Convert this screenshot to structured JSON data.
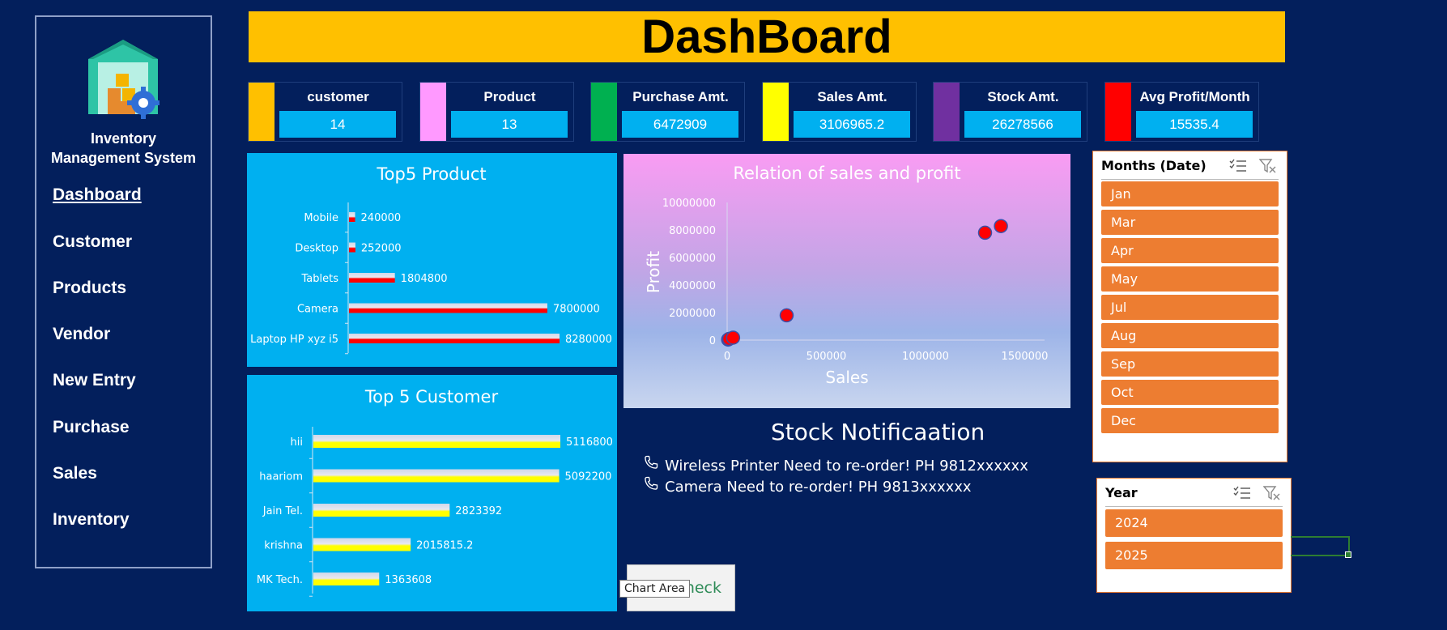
{
  "sidebar": {
    "title_line1": "Inventory",
    "title_line2": "Management System",
    "items": [
      {
        "label": "Dashboard",
        "active": true
      },
      {
        "label": "Customer"
      },
      {
        "label": "Products"
      },
      {
        "label": "Vendor"
      },
      {
        "label": "New Entry"
      },
      {
        "label": "Purchase"
      },
      {
        "label": "Sales"
      },
      {
        "label": "Inventory"
      }
    ]
  },
  "header": {
    "title": "DashBoard"
  },
  "kpis": [
    {
      "label": "customer",
      "value": "14",
      "color": "#ffc000"
    },
    {
      "label": "Product",
      "value": "13",
      "color": "#ff99ff"
    },
    {
      "label": "Purchase Amt.",
      "value": "6472909",
      "color": "#00b050"
    },
    {
      "label": "Sales Amt.",
      "value": "3106965.2",
      "color": "#ffff00"
    },
    {
      "label": "Stock Amt.",
      "value": "26278566",
      "color": "#7030a0"
    },
    {
      "label": "Avg Profit/Month",
      "value": "15535.4",
      "color": "#ff0000"
    }
  ],
  "chart_data": [
    {
      "type": "bar",
      "title": "Top5 Product",
      "categories": [
        "Mobile",
        "Desktop",
        "Tablets",
        "Camera",
        "Laptop HP xyz i5"
      ],
      "values": [
        240000,
        252000,
        1804800,
        7800000,
        8280000
      ],
      "data_labels": [
        "240000",
        "252000",
        "1804800",
        "7800000",
        "8280000"
      ],
      "orientation": "horizontal",
      "bar_color": "#ff0000"
    },
    {
      "type": "bar",
      "title": "Top 5 Customer",
      "categories": [
        "hii",
        "haariom",
        "Jain Tel.",
        "krishna",
        "MK Tech."
      ],
      "values": [
        5116800,
        5092200,
        2823392,
        2015815.2,
        1363608
      ],
      "data_labels": [
        "5116800",
        "5092200",
        "2823392",
        "2015815.2",
        "1363608"
      ],
      "orientation": "horizontal",
      "bar_color": "#ffff00"
    },
    {
      "type": "scatter",
      "title": "Relation of sales and profit",
      "xlabel": "Sales",
      "ylabel": "Profit",
      "xlim": [
        0,
        1600000
      ],
      "ylim": [
        0,
        10000000
      ],
      "x_ticks": [
        "0",
        "500000",
        "1000000",
        "1500000"
      ],
      "y_ticks": [
        "0",
        "2000000",
        "4000000",
        "6000000",
        "8000000",
        "10000000"
      ],
      "points": [
        {
          "x": 5000,
          "y": 40000
        },
        {
          "x": 10000,
          "y": 90000
        },
        {
          "x": 30000,
          "y": 180000
        },
        {
          "x": 300000,
          "y": 1800000
        },
        {
          "x": 1300000,
          "y": 7800000
        },
        {
          "x": 1380000,
          "y": 8280000
        }
      ],
      "point_color": "#ff0000"
    }
  ],
  "stock": {
    "title": "Stock Notificaation",
    "lines": [
      "Wireless Printer Need to re-order! PH 9812xxxxxx",
      "Camera Need to re-order! PH 9813xxxxxx"
    ]
  },
  "slicer_months": {
    "title": "Months (Date)",
    "items": [
      "Jan",
      "Mar",
      "Apr",
      "May",
      "Jul",
      "Aug",
      "Sep",
      "Oct",
      "Dec"
    ]
  },
  "slicer_year": {
    "title": "Year",
    "items": [
      "2024",
      "2025"
    ]
  },
  "check_button": {
    "label": "Check"
  },
  "tooltip": {
    "text": "Chart Area"
  },
  "icons": {
    "slicer_multiselect": "multi-select-icon",
    "slicer_clear": "clear-filter-icon",
    "phone": "phone-icon"
  }
}
